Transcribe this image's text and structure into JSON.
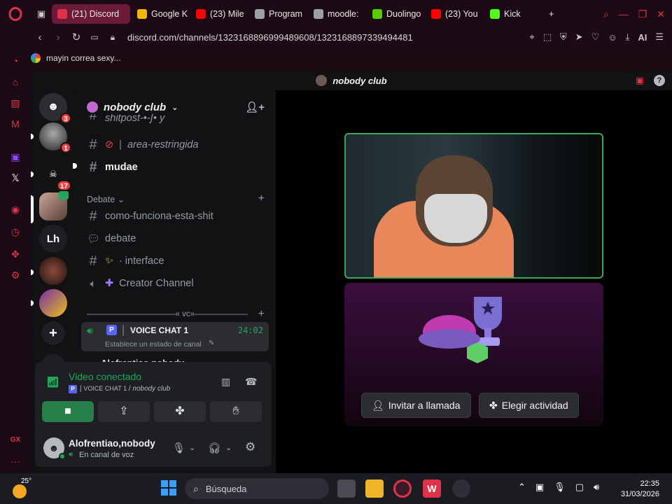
{
  "browser": {
    "tabs": [
      {
        "label": "(21) Discord",
        "badge": "21",
        "active": true,
        "color": "#e0324a"
      },
      {
        "label": "Google K",
        "active": false,
        "color": "#f4b400"
      },
      {
        "label": "(23) Mile",
        "active": false,
        "color": "#ff0000"
      },
      {
        "label": "Program",
        "active": false,
        "color": "#9aa0a6"
      },
      {
        "label": "moodle:",
        "active": false,
        "color": "#9aa0a6"
      },
      {
        "label": "Duolingo",
        "active": false,
        "color": "#58cc02"
      },
      {
        "label": "(23) You",
        "active": false,
        "color": "#ff0000"
      },
      {
        "label": "Kick",
        "active": false,
        "color": "#53fc18"
      }
    ],
    "url": "discord.com/channels/1323168896999489608/1323168897339494481",
    "bookmark": "mayin correa sexy...",
    "ai_label": "AI"
  },
  "discord": {
    "window_title": "nobody club",
    "guild_name": "nobody club",
    "server_badges": [
      "3",
      "1",
      "17"
    ],
    "server_lh": "Lh",
    "channels": {
      "top_partial": "shitpost-•-ʃ• y",
      "restricted": "area-restringida",
      "mudae": "mudae",
      "category_debate": "Debate",
      "como": "como-funciona-esta-shit",
      "debate": "debate",
      "interface": "· interface",
      "creator": "Creator Channel",
      "vc_category": "———————————« vc»———————————",
      "voice_chat": "VOICE CHAT 1",
      "voice_time": "24:02",
      "voice_status": "Establece un estado de canal",
      "voice_user_partial": "Alofrentiao.nobody"
    },
    "voice_panel": {
      "status": "Video conectado",
      "channel": "VOICE CHAT 1",
      "server": "nobody club"
    },
    "user": {
      "name": "Alofrentiao,nobody",
      "status": "En canal de voz"
    },
    "stage": {
      "invite_label": "Invitar a llamada",
      "activity_label": "Elegir actividad"
    }
  },
  "taskbar": {
    "weather": "25°",
    "search_placeholder": "Búsqueda",
    "time": "22:35",
    "date": "31/03/2026"
  },
  "colors": {
    "accent_opera": "#e0324a",
    "discord_green": "#23a55a",
    "video_border": "#3ba55c"
  }
}
